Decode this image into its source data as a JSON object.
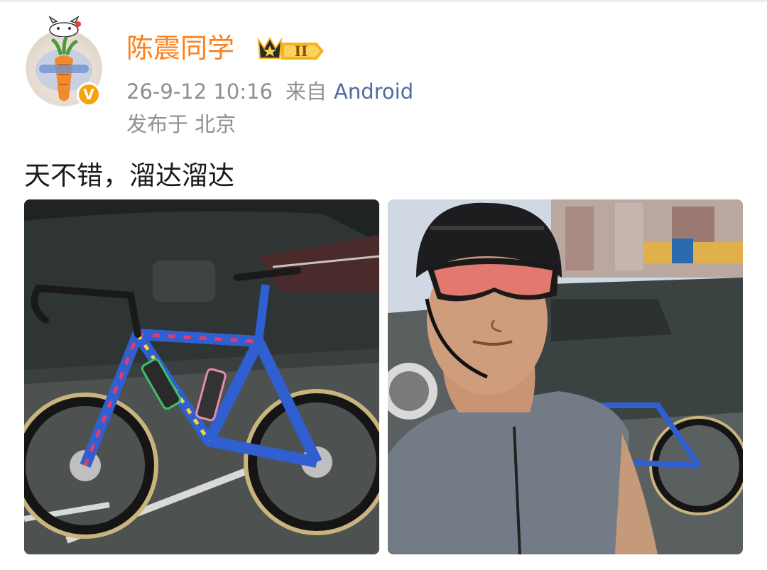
{
  "user": {
    "name": "陈震同学",
    "vip_level": "II",
    "verified_badge": "V"
  },
  "meta": {
    "time": "26-9-12 10:16",
    "from_label": "来自",
    "source": "Android",
    "location": "发布于 北京"
  },
  "post": {
    "text": "天不错，溜达溜达"
  },
  "colors": {
    "username": "#ff7e18",
    "source_link": "#506b9e",
    "meta": "#8f8f8f",
    "vip_gold": "#f6b21a"
  }
}
